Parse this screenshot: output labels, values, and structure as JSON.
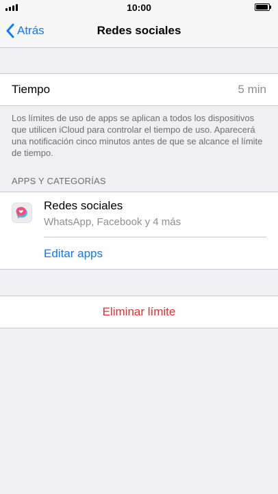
{
  "status_bar": {
    "time": "10:00"
  },
  "nav": {
    "back_label": "Atrás",
    "title": "Redes sociales"
  },
  "time_limit": {
    "label": "Tiempo",
    "value": "5 min"
  },
  "note": "Los límites de uso de apps se aplican a todos los dispositivos que utilicen iCloud para controlar el tiempo de uso. Aparecerá una notificación cinco minutos antes de que se alcance el límite de tiempo.",
  "section_header": "APPS Y CATEGORÍAS",
  "category": {
    "title": "Redes sociales",
    "subtitle": "WhatsApp, Facebook y 4 más",
    "icon": "social-chat-bubbles-icon"
  },
  "edit_apps_label": "Editar apps",
  "delete_label": "Eliminar límite",
  "colors": {
    "accent": "#0a7aff",
    "destructive": "#e0302a",
    "background": "#efeff4",
    "secondary_text": "#8e8e93"
  }
}
